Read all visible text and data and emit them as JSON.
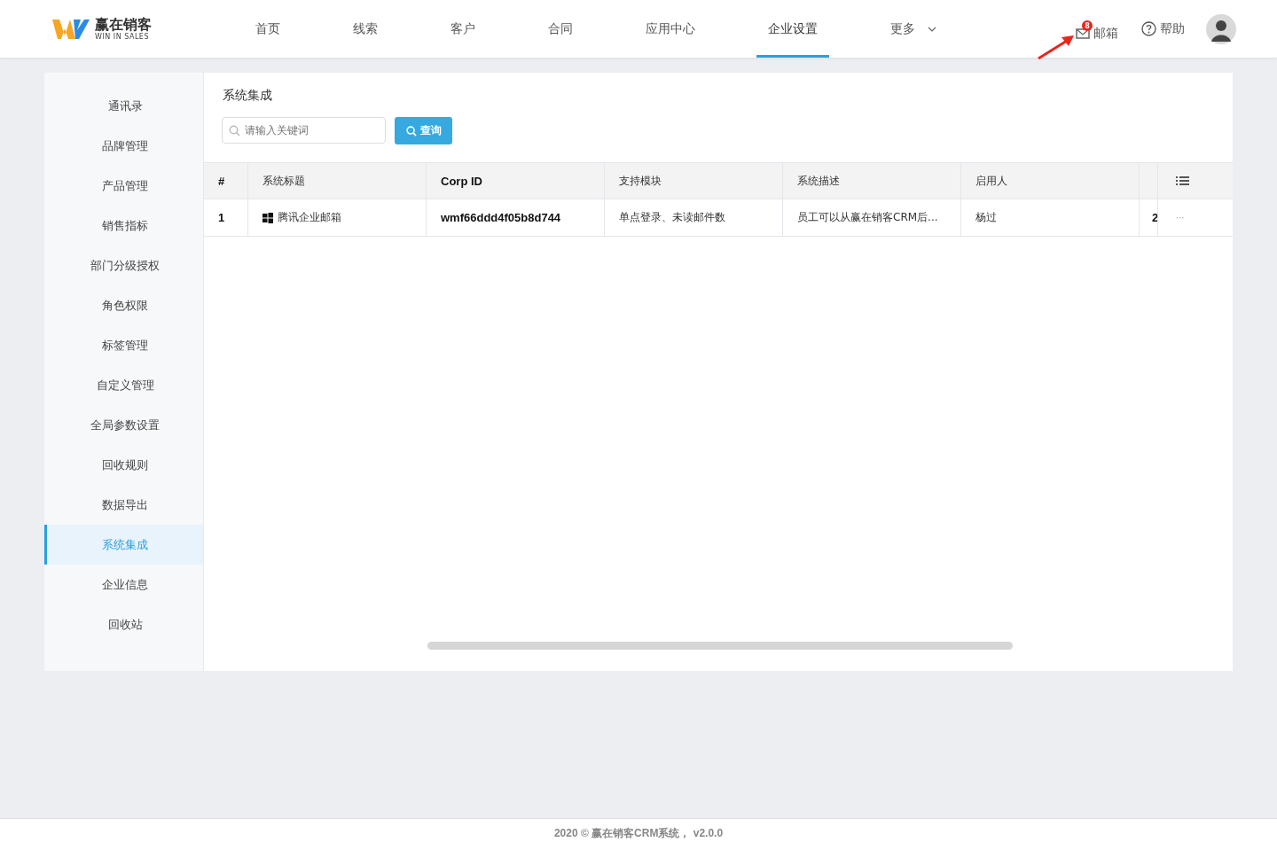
{
  "logo": {
    "name": "赢在销客",
    "tagline": "WIN IN SALES"
  },
  "nav": [
    {
      "label": "首页",
      "selected": false
    },
    {
      "label": "线索",
      "selected": false
    },
    {
      "label": "客户",
      "selected": false
    },
    {
      "label": "合同",
      "selected": false
    },
    {
      "label": "应用中心",
      "selected": false
    },
    {
      "label": "企业设置",
      "selected": true
    },
    {
      "label": "更多",
      "selected": false,
      "kind": "dropdown"
    }
  ],
  "header_actions": {
    "mail": {
      "label": "邮箱",
      "badge": "8"
    },
    "help": {
      "label": "帮助"
    }
  },
  "sidebar": {
    "items": [
      {
        "label": "通讯录",
        "selected": false
      },
      {
        "label": "品牌管理",
        "selected": false
      },
      {
        "label": "产品管理",
        "selected": false
      },
      {
        "label": "销售指标",
        "selected": false
      },
      {
        "label": "部门分级授权",
        "selected": false
      },
      {
        "label": "角色权限",
        "selected": false
      },
      {
        "label": "标签管理",
        "selected": false
      },
      {
        "label": "自定义管理",
        "selected": false
      },
      {
        "label": "全局参数设置",
        "selected": false
      },
      {
        "label": "回收规则",
        "selected": false
      },
      {
        "label": "数据导出",
        "selected": false
      },
      {
        "label": "系统集成",
        "selected": true
      },
      {
        "label": "企业信息",
        "selected": false
      },
      {
        "label": "回收站",
        "selected": false
      }
    ]
  },
  "page_title": "系统集成",
  "search": {
    "placeholder": "请输入关键词",
    "button": "查询"
  },
  "table": {
    "columns": [
      "#",
      "系统标题",
      "Corp ID",
      "支持模块",
      "系统描述",
      "启用人"
    ],
    "rows": [
      {
        "cells": [
          "1",
          "腾讯企业邮箱",
          "wmf66ddd4f05b8d744",
          "单点登录、未读邮件数",
          "员工可以从赢在销客CRM后...",
          "杨过",
          "2",
          "···"
        ]
      }
    ]
  },
  "footer": "2020 © 赢在销客CRM系统， v2.0.0"
}
